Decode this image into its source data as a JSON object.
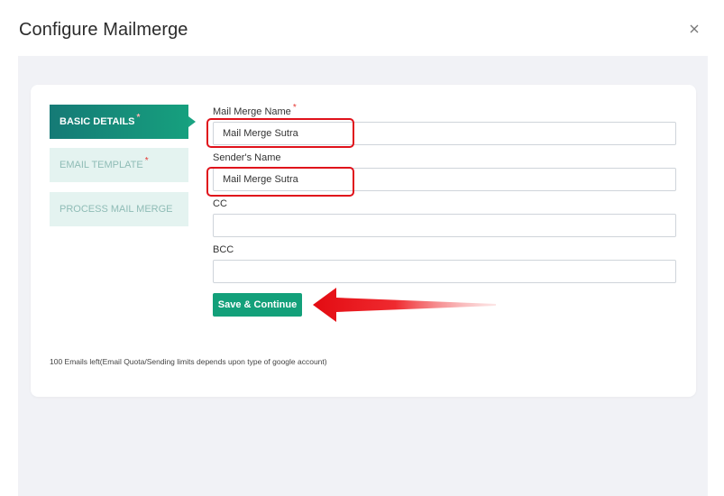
{
  "dialog": {
    "title": "Configure Mailmerge",
    "close_icon": "close-icon"
  },
  "steps": [
    {
      "label": "BASIC DETAILS",
      "required": "*",
      "active": true
    },
    {
      "label": "EMAIL TEMPLATE",
      "required": "*",
      "active": false
    },
    {
      "label": "PROCESS MAIL MERGE",
      "required": "",
      "active": false
    }
  ],
  "form": {
    "mail_merge_name": {
      "label": "Mail Merge Name",
      "required": "*",
      "value": "Mail Merge Sutra"
    },
    "senders_name": {
      "label": "Sender's Name",
      "value": "Mail Merge Sutra"
    },
    "cc": {
      "label": "CC",
      "value": ""
    },
    "bcc": {
      "label": "BCC",
      "value": ""
    },
    "save_label": "Save & Continue"
  },
  "quota_text": "100 Emails left(Email Quota/Sending limits depends upon type of google account)",
  "colors": {
    "accent": "#13a07a",
    "active_step": "#0e7a72",
    "highlight": "#e0121b",
    "required": "#e53935"
  }
}
